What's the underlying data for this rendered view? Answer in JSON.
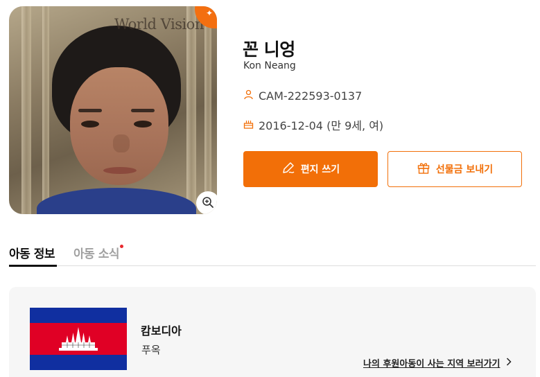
{
  "child": {
    "watermark": "World Vision",
    "name_ko": "꼰 니엉",
    "name_en": "Kon Neang",
    "child_id": "CAM-222593-0137",
    "birth_info": "2016-12-04 (만 9세, 여)"
  },
  "icons": {
    "id": "person-icon",
    "birth": "cake-icon",
    "zoom": "zoom-in-icon",
    "letter": "pen-icon",
    "gift": "gift-icon",
    "chevron": "chevron-right-icon"
  },
  "actions": {
    "write_letter": "편지 쓰기",
    "send_gift": "선물금 보내기"
  },
  "tabs": [
    {
      "label": "아동 정보",
      "active": true
    },
    {
      "label": "아동 소식",
      "active": false,
      "has_new": true
    }
  ],
  "location": {
    "country": "캄보디아",
    "region": "푸옥",
    "map_link": "나의 후원아동이 사는 지역 보러가기"
  },
  "colors": {
    "accent": "#f26f08",
    "new_dot": "#e8282d"
  }
}
